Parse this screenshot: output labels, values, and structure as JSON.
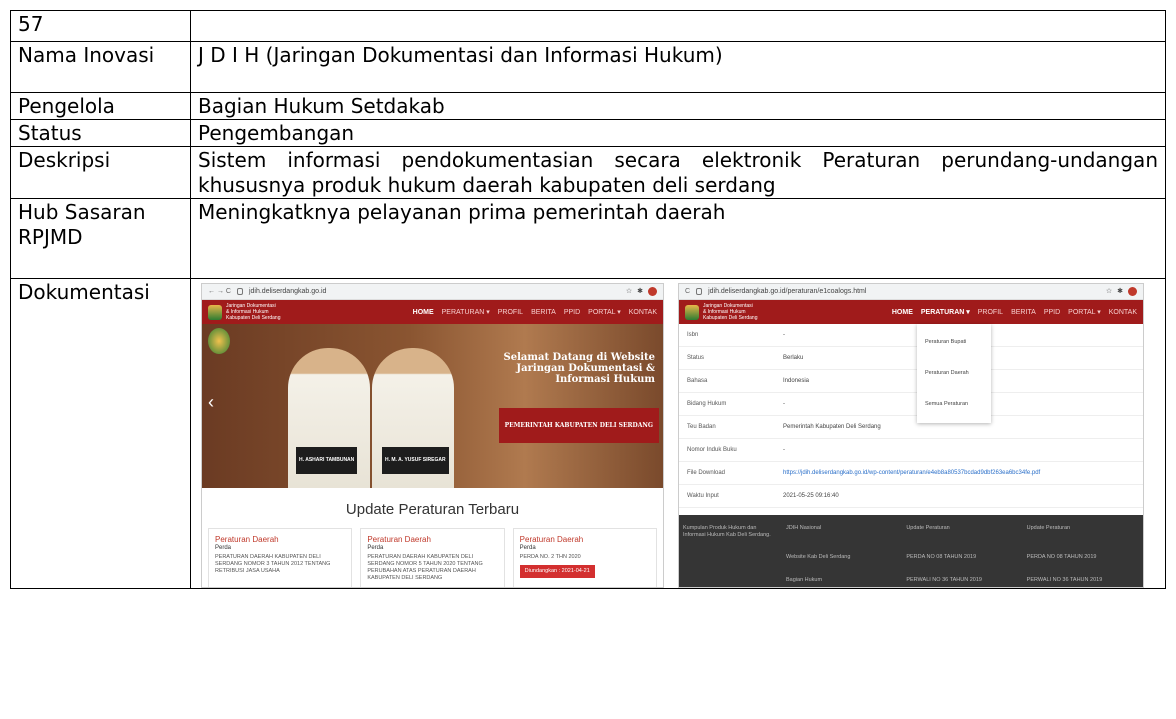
{
  "doc": {
    "number": "57",
    "rows": [
      {
        "label": "Nama Inovasi",
        "value": "J D I H (Jaringan Dokumentasi dan Informasi Hukum)"
      },
      {
        "label": "Pengelola",
        "value": "Bagian Hukum Setdakab"
      },
      {
        "label": "Status",
        "value": "Pengembangan"
      },
      {
        "label": "Deskripsi",
        "value": "Sistem informasi pendokumentasian secara elektronik Peraturan perundang-undangan khususnya produk hukum daerah kabupaten deli serdang"
      },
      {
        "label": "Hub Sasaran RPJMD",
        "value": "Meningkatknya pelayanan prima pemerintah daerah"
      },
      {
        "label": "Dokumentasi",
        "value": ""
      }
    ]
  },
  "shot1": {
    "url": "jdih.deliserdangkab.go.id",
    "logo_line1": "Jaringan Dokumentasi",
    "logo_line2": "& Informasi Hukum",
    "logo_line3": "Kabupaten Deli Serdang",
    "nav": [
      "HOME",
      "PERATURAN ▾",
      "PROFIL",
      "BERITA",
      "PPID",
      "PORTAL ▾",
      "KONTAK"
    ],
    "welcome": "Selamat Datang di Website Jaringan Dokumentasi & Informasi Hukum",
    "banner": "PEMERINTAH KABUPATEN DELI SERDANG",
    "caption1": "H. ASHARI TAMBUNAN",
    "caption2": "H. M. A. YUSUF SIREGAR",
    "update_title": "Update Peraturan Terbaru",
    "cards": [
      {
        "title": "Peraturan Daerah",
        "kind": "Perda",
        "text": "PERATURAN DAERAH KABUPATEN DELI SERDANG NOMOR 3 TAHUN 2012 TENTANG RETRIBUSI JASA USAHA",
        "badge": ""
      },
      {
        "title": "Peraturan Daerah",
        "kind": "Perda",
        "text": "PERATURAN DAERAH KABUPATEN DELI SERDANG NOMOR 5 TAHUN 2020 TENTANG PERUBAHAN ATAS PERATURAN DAERAH KABUPATEN DELI SERDANG",
        "badge": ""
      },
      {
        "title": "Peraturan Daerah",
        "kind": "Perda",
        "text": "PERDA NO. 2 THN 2020",
        "badge": "Diundangkan : 2021-04-21"
      }
    ]
  },
  "shot2": {
    "url": "jdih.deliserdangkab.go.id/peraturan/e1coalogs.html",
    "nav": [
      "HOME",
      "PERATURAN ▾",
      "PROFIL",
      "BERITA",
      "PPID",
      "PORTAL ▾",
      "KONTAK"
    ],
    "dropdown": [
      "Peraturan Bupati",
      "Peraturan Daerah",
      "Semua Peraturan"
    ],
    "fields": [
      {
        "k": "Isbn",
        "v": "-"
      },
      {
        "k": "Status",
        "v": "Berlaku"
      },
      {
        "k": "Bahasa",
        "v": "Indonesia"
      },
      {
        "k": "Bidang Hukum",
        "v": "-"
      },
      {
        "k": "Teu Badan",
        "v": "Pemerintah Kabupaten Deli Serdang"
      },
      {
        "k": "Nomor Induk Buku",
        "v": "-"
      },
      {
        "k": "File Download",
        "v": "https://jdih.deliserdangkab.go.id/wp-content/peraturan/e4eb8a80537bcdad9dbf263ea6bc34fe.pdf"
      },
      {
        "k": "Waktu Input",
        "v": "2021-05-25 09:16:40"
      }
    ],
    "footer": [
      "Kumpulan Produk Hukum dan Informasi Hukum Kab Deli Serdang.",
      "JDIH Nasional",
      "Update Peraturan",
      "Update Peraturan",
      "",
      "Website Kab Deli Serdang",
      "PERDA NO 08 TAHUN 2019",
      "PERDA NO 08 TAHUN 2019",
      "",
      "Bagian Hukum",
      "PERWALI NO 36 TAHUN 2019",
      "PERWALI NO 36 TAHUN 2019"
    ]
  }
}
